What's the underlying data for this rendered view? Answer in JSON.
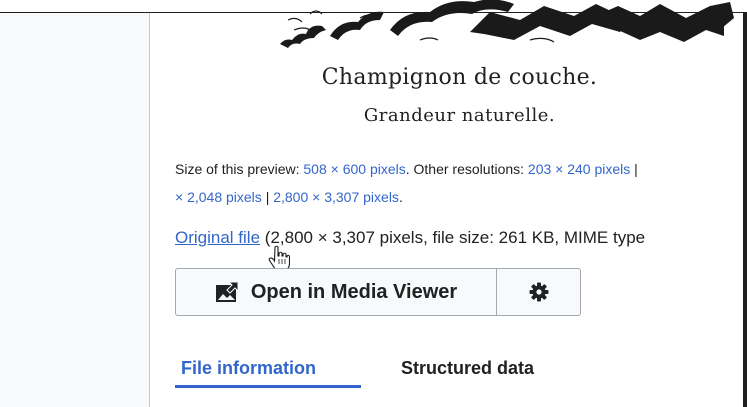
{
  "caption": {
    "line1": "Champignon de couche.",
    "line2": "Grandeur naturelle."
  },
  "preview": {
    "label": "Size of this preview:",
    "size_link": "508 × 600 pixels",
    "other_label": ". Other resolutions:",
    "res1": "203 × 240 pixels",
    "res1_sep": "|",
    "line2_res_a": "× 2,048 pixels",
    "sep": "|",
    "line2_res_b": "2,800 × 3,307 pixels",
    "line2_end": "."
  },
  "original": {
    "link": "Original file",
    "details": "(2,800 × 3,307 pixels, file size: 261 KB, MIME type"
  },
  "buttons": {
    "open_media_viewer": "Open in Media Viewer"
  },
  "tabs": [
    "File information",
    "Structured data"
  ],
  "colors": {
    "link": "#3366cc",
    "text": "#202122"
  }
}
